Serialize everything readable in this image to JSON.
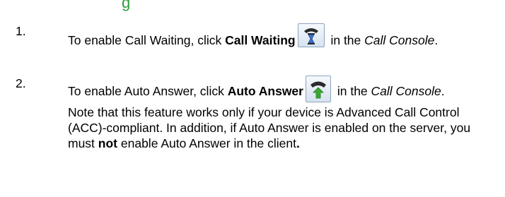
{
  "heading": {
    "partial_text": "g"
  },
  "steps": [
    {
      "number": "1.",
      "pre": "To enable Call Waiting, click ",
      "bold": "Call Waiting",
      "icon": "hourglass-phone-icon",
      "mid": " in the ",
      "italic": "Call Console",
      "post": "."
    },
    {
      "number": "2.",
      "pre": "To enable Auto Answer, click ",
      "bold": "Auto Answer",
      "icon": "auto-answer-phone-icon",
      "mid": " in the ",
      "italic": "Call Console",
      "post": ".",
      "note": {
        "part1": "Note that this feature works only if your device is Advanced Call Control (ACC)-compliant.  In addition, if Auto Answer is enabled on the server, you must ",
        "bold": "not",
        "part2": " enable Auto Answer in the client",
        "bold_end": "."
      }
    }
  ],
  "colors": {
    "heading": "#2e9e3f",
    "icon_arrow": "#3aa832",
    "icon_hourglass": "#3b6fd0"
  }
}
